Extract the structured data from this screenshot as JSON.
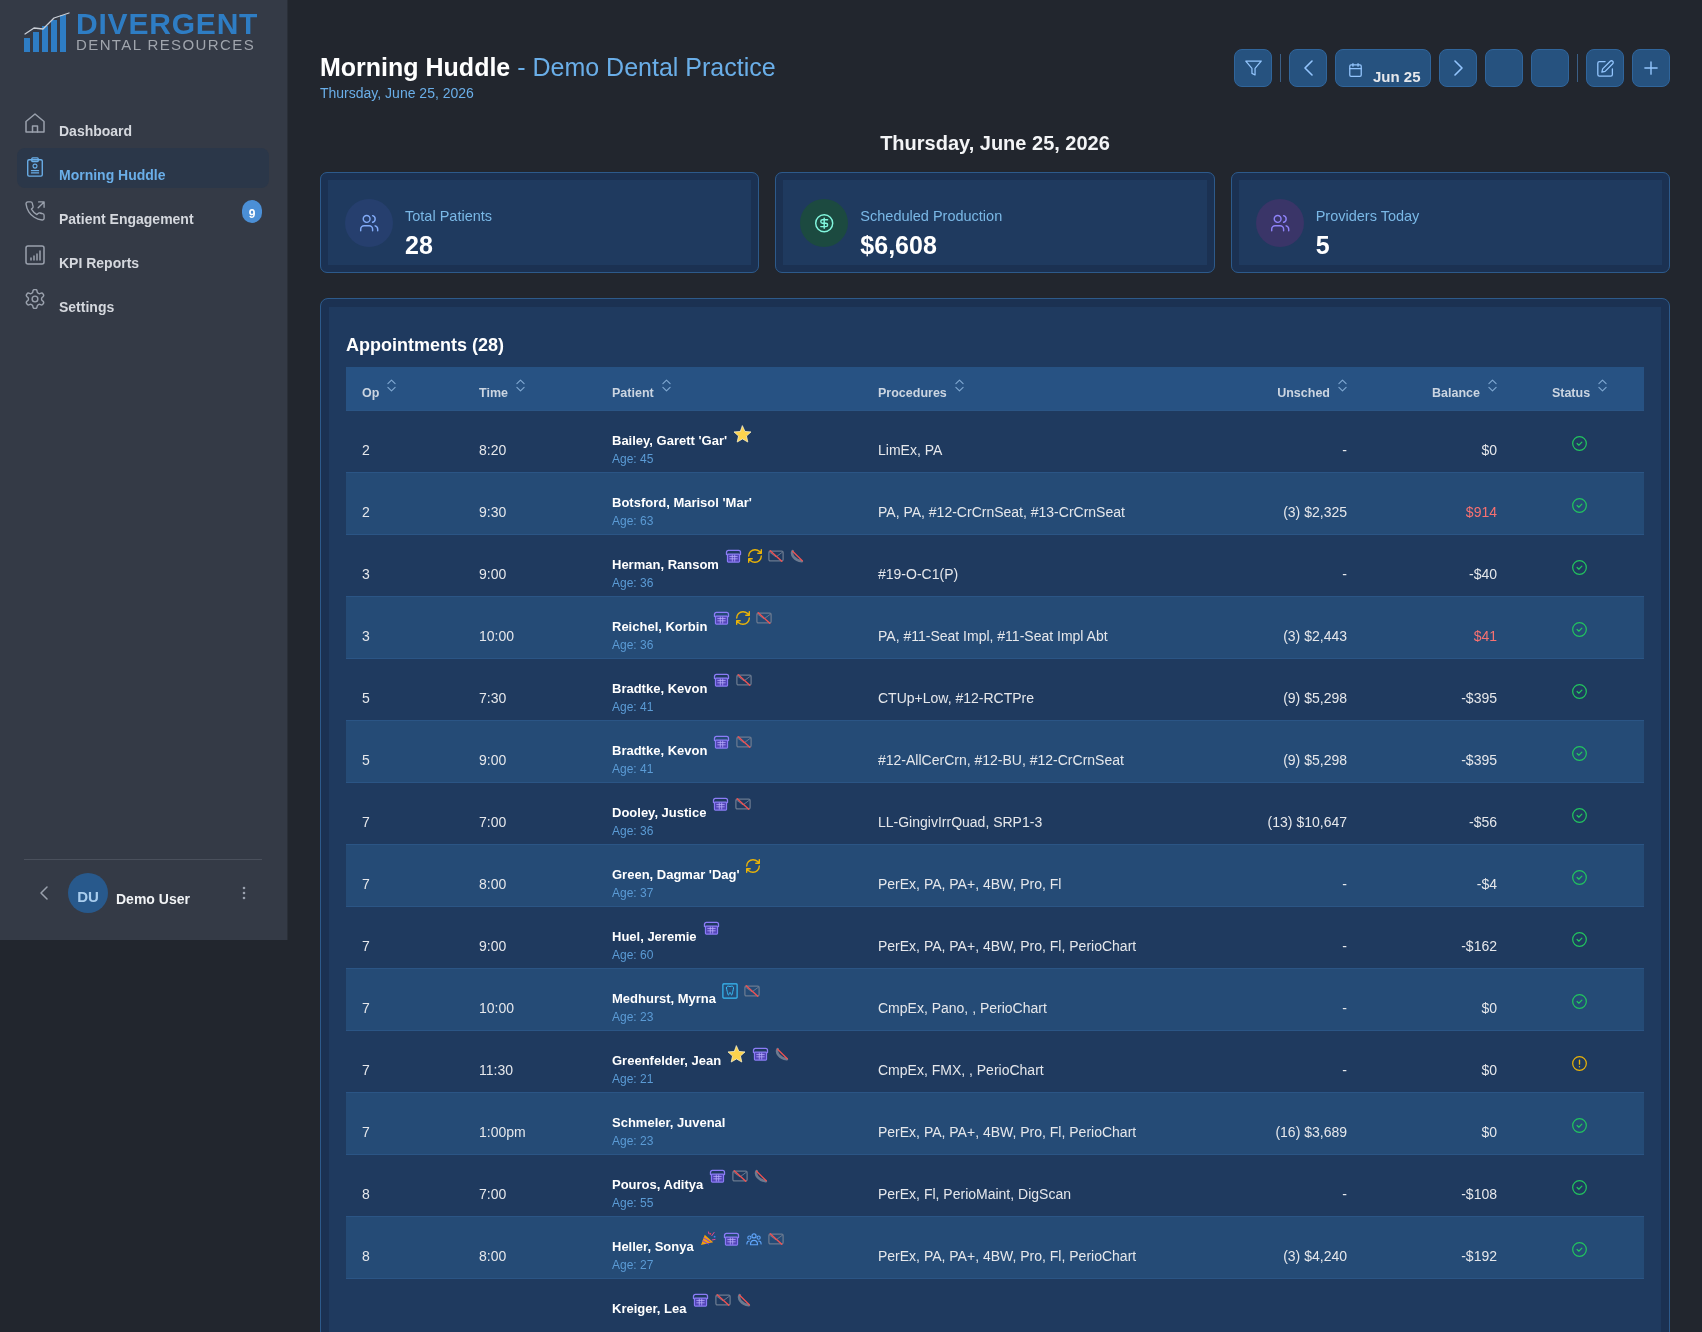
{
  "sidebar": {
    "logo": {
      "name": "DIVERGENT",
      "tagline": "DENTAL RESOURCES"
    },
    "items": [
      {
        "label": "Dashboard",
        "kind": "home",
        "selected": false
      },
      {
        "label": "Morning Huddle",
        "kind": "clipboard",
        "selected": true
      },
      {
        "label": "Patient Engagement",
        "kind": "phone",
        "selected": false,
        "badge": "9"
      },
      {
        "label": "KPI Reports",
        "kind": "chart",
        "selected": false
      },
      {
        "label": "Settings",
        "kind": "gear",
        "selected": false
      }
    ],
    "user": {
      "initials": "DU",
      "name": "Demo User"
    }
  },
  "header": {
    "title": "**Morning Huddle** - Demo Dental Practice",
    "subtitle": "Thursday, June 25, 2026",
    "toolbar": [
      {
        "kind": "filter"
      },
      {
        "kind": "divider"
      },
      {
        "kind": "prev"
      },
      {
        "kind": "date",
        "label": "Jun 25"
      },
      {
        "kind": "next"
      },
      {
        "kind": "blank"
      },
      {
        "kind": "blank"
      },
      {
        "kind": "divider"
      },
      {
        "kind": "edit"
      },
      {
        "kind": "add"
      }
    ]
  },
  "date_heading": "Thursday, June 25, 2026",
  "stats": [
    {
      "kind": "people",
      "color": "#263f6e",
      "label": "Total Patients",
      "value": "28"
    },
    {
      "kind": "money",
      "color": "#1c4a40",
      "label": "Scheduled Production",
      "value": "$6,608"
    },
    {
      "kind": "people",
      "color": "#3a3568",
      "label": "Providers Today",
      "value": "5"
    }
  ],
  "appointments": {
    "title": "Appointments (28)",
    "columns": [
      "Op",
      "Time",
      "Patient",
      "Procedures",
      "Unsched",
      "Balance",
      "Status"
    ],
    "rows": [
      {
        "op": "2",
        "time": "8:20",
        "patient": "Bailey, Garett 'Gar'",
        "age": "Age: 45",
        "flags": [
          {
            "kind": "star"
          }
        ],
        "procedures": "LimEx, PA",
        "unsched": "-",
        "balance": "$0",
        "owed": false,
        "status": {
          "kind": "check"
        }
      },
      {
        "op": "2",
        "time": "9:30",
        "patient": "Botsford, Marisol 'Mar'",
        "age": "Age: 63",
        "flags": [],
        "procedures": "PA, PA, #12-CrCrnSeat, #13-CrCrnSeat",
        "unsched": "(3) $2,325",
        "balance": "$914",
        "owed": true,
        "status": {
          "kind": "check"
        }
      },
      {
        "op": "3",
        "time": "9:00",
        "patient": "Herman, Ransom",
        "age": "Age: 36",
        "flags": [
          {
            "kind": "deskphone"
          },
          {
            "kind": "sync"
          },
          {
            "kind": "noemail"
          },
          {
            "kind": "nocall"
          }
        ],
        "procedures": "#19-O-C1(P)",
        "unsched": "-",
        "balance": "-$40",
        "owed": false,
        "status": {
          "kind": "check"
        }
      },
      {
        "op": "3",
        "time": "10:00",
        "patient": "Reichel, Korbin",
        "age": "Age: 36",
        "flags": [
          {
            "kind": "deskphone"
          },
          {
            "kind": "sync"
          },
          {
            "kind": "noemail"
          }
        ],
        "procedures": "PA, #11-Seat Impl, #11-Seat Impl Abt",
        "unsched": "(3) $2,443",
        "balance": "$41",
        "owed": true,
        "status": {
          "kind": "check"
        }
      },
      {
        "op": "5",
        "time": "7:30",
        "patient": "Bradtke, Kevon",
        "age": "Age: 41",
        "flags": [
          {
            "kind": "deskphone"
          },
          {
            "kind": "noemail"
          }
        ],
        "procedures": "CTUp+Low, #12-RCTPre",
        "unsched": "(9) $5,298",
        "balance": "-$395",
        "owed": false,
        "status": {
          "kind": "check"
        }
      },
      {
        "op": "5",
        "time": "9:00",
        "patient": "Bradtke, Kevon",
        "age": "Age: 41",
        "flags": [
          {
            "kind": "deskphone"
          },
          {
            "kind": "noemail"
          }
        ],
        "procedures": "#12-AllCerCrn, #12-BU, #12-CrCrnSeat",
        "unsched": "(9) $5,298",
        "balance": "-$395",
        "owed": false,
        "status": {
          "kind": "check"
        }
      },
      {
        "op": "7",
        "time": "7:00",
        "patient": "Dooley, Justice",
        "age": "Age: 36",
        "flags": [
          {
            "kind": "deskphone"
          },
          {
            "kind": "noemail"
          }
        ],
        "procedures": "LL-GingivIrrQuad, SRP1-3",
        "unsched": "(13) $10,647",
        "balance": "-$56",
        "owed": false,
        "status": {
          "kind": "check"
        }
      },
      {
        "op": "7",
        "time": "8:00",
        "patient": "Green, Dagmar 'Dag'",
        "age": "Age: 37",
        "flags": [
          {
            "kind": "sync"
          }
        ],
        "procedures": "PerEx, PA, PA+, 4BW, Pro, Fl",
        "unsched": "-",
        "balance": "-$4",
        "owed": false,
        "status": {
          "kind": "check"
        }
      },
      {
        "op": "7",
        "time": "9:00",
        "patient": "Huel, Jeremie",
        "age": "Age: 60",
        "flags": [
          {
            "kind": "deskphone"
          }
        ],
        "procedures": "PerEx, PA, PA+, 4BW, Pro, Fl, PerioChart",
        "unsched": "-",
        "balance": "-$162",
        "owed": false,
        "status": {
          "kind": "check"
        }
      },
      {
        "op": "7",
        "time": "10:00",
        "patient": "Medhurst, Myrna",
        "age": "Age: 23",
        "flags": [
          {
            "kind": "tooth"
          },
          {
            "kind": "noemail"
          }
        ],
        "procedures": "CmpEx, Pano, , PerioChart",
        "unsched": "-",
        "balance": "$0",
        "owed": false,
        "status": {
          "kind": "check"
        }
      },
      {
        "op": "7",
        "time": "11:30",
        "patient": "Greenfelder, Jean",
        "age": "Age: 21",
        "flags": [
          {
            "kind": "star"
          },
          {
            "kind": "deskphone"
          },
          {
            "kind": "nocall"
          }
        ],
        "procedures": "CmpEx, FMX, , PerioChart",
        "unsched": "-",
        "balance": "$0",
        "owed": false,
        "status": {
          "kind": "alert"
        }
      },
      {
        "op": "7",
        "time": "1:00pm",
        "patient": "Schmeler, Juvenal",
        "age": "Age: 23",
        "flags": [],
        "procedures": "PerEx, PA, PA+, 4BW, Pro, Fl, PerioChart",
        "unsched": "(16) $3,689",
        "balance": "$0",
        "owed": false,
        "status": {
          "kind": "check"
        }
      },
      {
        "op": "8",
        "time": "7:00",
        "patient": "Pouros, Aditya",
        "age": "Age: 55",
        "flags": [
          {
            "kind": "deskphone"
          },
          {
            "kind": "noemail"
          },
          {
            "kind": "nocall"
          }
        ],
        "procedures": "PerEx, Fl, PerioMaint, DigScan",
        "unsched": "-",
        "balance": "-$108",
        "owed": false,
        "status": {
          "kind": "check"
        }
      },
      {
        "op": "8",
        "time": "8:00",
        "patient": "Heller, Sonya",
        "age": "Age: 27",
        "flags": [
          {
            "kind": "party"
          },
          {
            "kind": "deskphone"
          },
          {
            "kind": "group"
          },
          {
            "kind": "noemail"
          }
        ],
        "procedures": "PerEx, PA, PA+, 4BW, Pro, Fl, PerioChart",
        "unsched": "(3) $4,240",
        "balance": "-$192",
        "owed": false,
        "status": {
          "kind": "check"
        }
      },
      {
        "patient": "Kreiger, Lea",
        "flags": [
          {
            "kind": "deskphone"
          },
          {
            "kind": "noemail"
          },
          {
            "kind": "nocall"
          }
        ]
      }
    ]
  }
}
